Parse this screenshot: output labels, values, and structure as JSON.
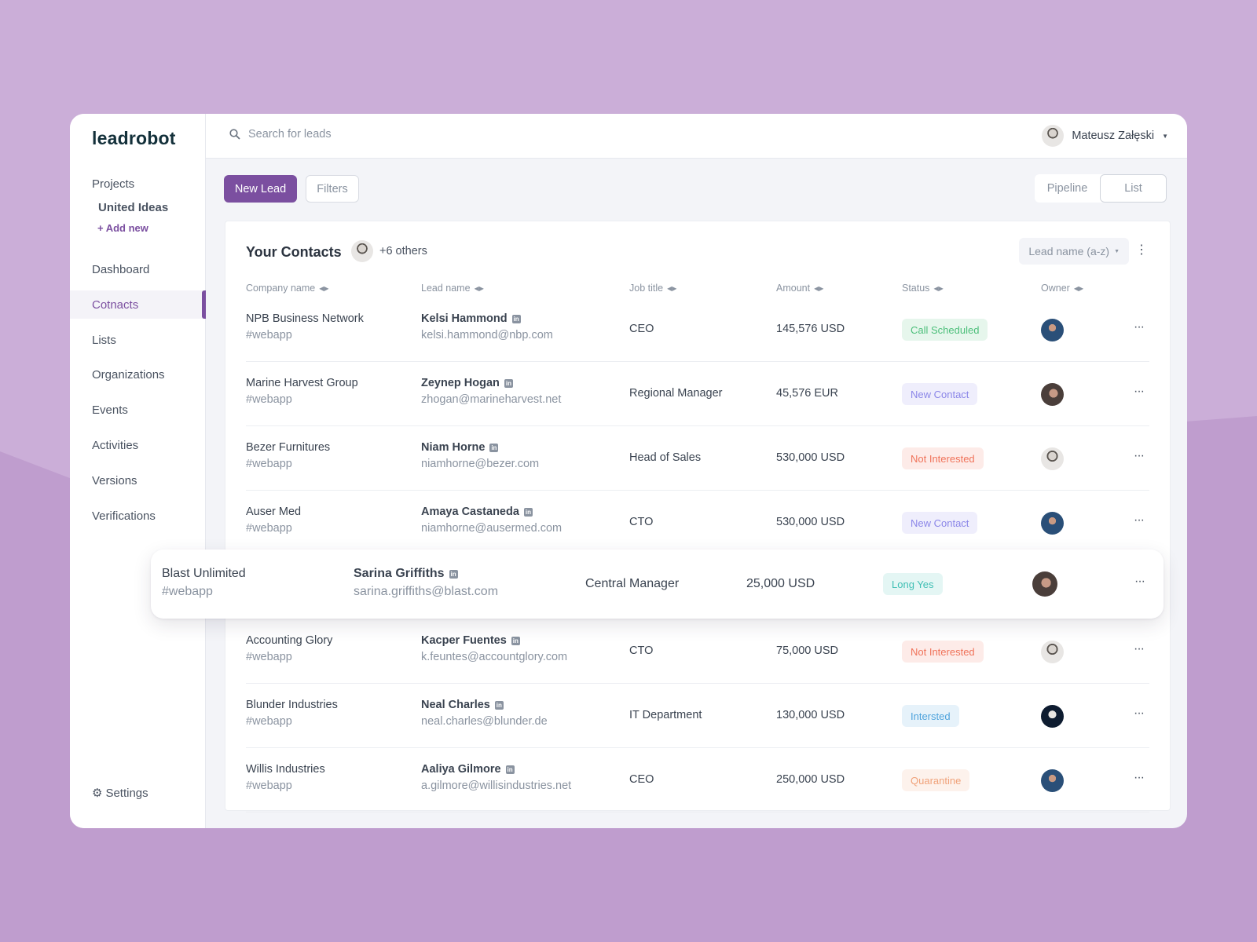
{
  "app": {
    "logo": "leadrobot"
  },
  "sidebar": {
    "projects_label": "Projects",
    "project": "United Ideas",
    "add_new": "+ Add new",
    "items": [
      {
        "label": "Dashboard"
      },
      {
        "label": "Cotnacts",
        "active": true
      },
      {
        "label": "Lists"
      },
      {
        "label": "Organizations"
      },
      {
        "label": "Events"
      },
      {
        "label": "Activities"
      },
      {
        "label": "Versions"
      },
      {
        "label": "Verifications"
      }
    ],
    "settings": "Settings"
  },
  "header": {
    "search_placeholder": "Search for leads",
    "user_name": "Mateusz Załęski"
  },
  "toolbar": {
    "new_lead": "New Lead",
    "filters": "Filters",
    "views": [
      "Pipeline",
      "List"
    ],
    "active_view": "List"
  },
  "contacts": {
    "title": "Your Contacts",
    "others": "+6 others",
    "sort": "Lead name (a-z)",
    "columns": [
      "Company name",
      "Lead name",
      "Job title",
      "Amount",
      "Status",
      "Owner"
    ],
    "rows": [
      {
        "company": "NPB Business Network",
        "tag": "#webapp",
        "lead": "Kelsi Hammond",
        "email": "kelsi.hammond@nbp.com",
        "job": "CEO",
        "amount": "145,576 USD",
        "status": "Call Scheduled",
        "status_color": "#4cbf7a",
        "owner_avatar": "b"
      },
      {
        "company": "Marine Harvest Group",
        "tag": "#webapp",
        "lead": "Zeynep Hogan",
        "email": "zhogan@marineharvest.net",
        "job": "Regional Manager",
        "amount": "45,576 EUR",
        "status": "New Contact",
        "status_color": "#8b86e8",
        "owner_avatar": "f"
      },
      {
        "company": "Bezer Furnitures",
        "tag": "#webapp",
        "lead": "Niam Horne",
        "email": "niamhorne@bezer.com",
        "job": "Head of Sales",
        "amount": "530,000 USD",
        "status": "Not Interested",
        "status_color": "#f0735a",
        "owner_avatar": "g"
      },
      {
        "company": "Auser Med",
        "tag": "#webapp",
        "lead": "Amaya Castaneda",
        "email": "niamhorne@ausermed.com",
        "job": "CTO",
        "amount": "530,000 USD",
        "status": "New Contact",
        "status_color": "#8b86e8",
        "owner_avatar": "b"
      },
      {
        "company": "Blast Unlimited",
        "tag": "#webapp",
        "lead": "Sarina Griffiths",
        "email": "sarina.griffiths@blast.com",
        "job": "Central Manager",
        "amount": "25,000 USD",
        "status": "Long Yes",
        "status_color": "#3fbfb4",
        "owner_avatar": "f",
        "highlighted": true
      },
      {
        "company": "Accounting Glory",
        "tag": "#webapp",
        "lead": "Kacper Fuentes",
        "email": "k.feuntes@accountglory.com",
        "job": "CTO",
        "amount": "75,000 USD",
        "status": "Not Interested",
        "status_color": "#f0735a",
        "owner_avatar": "g"
      },
      {
        "company": "Blunder Industries",
        "tag": "#webapp",
        "lead": "Neal Charles",
        "email": "neal.charles@blunder.de",
        "job": "IT Department",
        "amount": "130,000 USD",
        "status": "Intersted",
        "status_color": "#4ea3dc",
        "owner_avatar": "d"
      },
      {
        "company": "Willis Industries",
        "tag": "#webapp",
        "lead": "Aaliya Gilmore",
        "email": "a.gilmore@willisindustries.net",
        "job": "CEO",
        "amount": "250,000 USD",
        "status": "Quarantine",
        "status_color": "#f0a27a",
        "owner_avatar": "b"
      }
    ]
  },
  "colors": {
    "accent": "#7b4fa0",
    "background": "#cbaed8"
  }
}
